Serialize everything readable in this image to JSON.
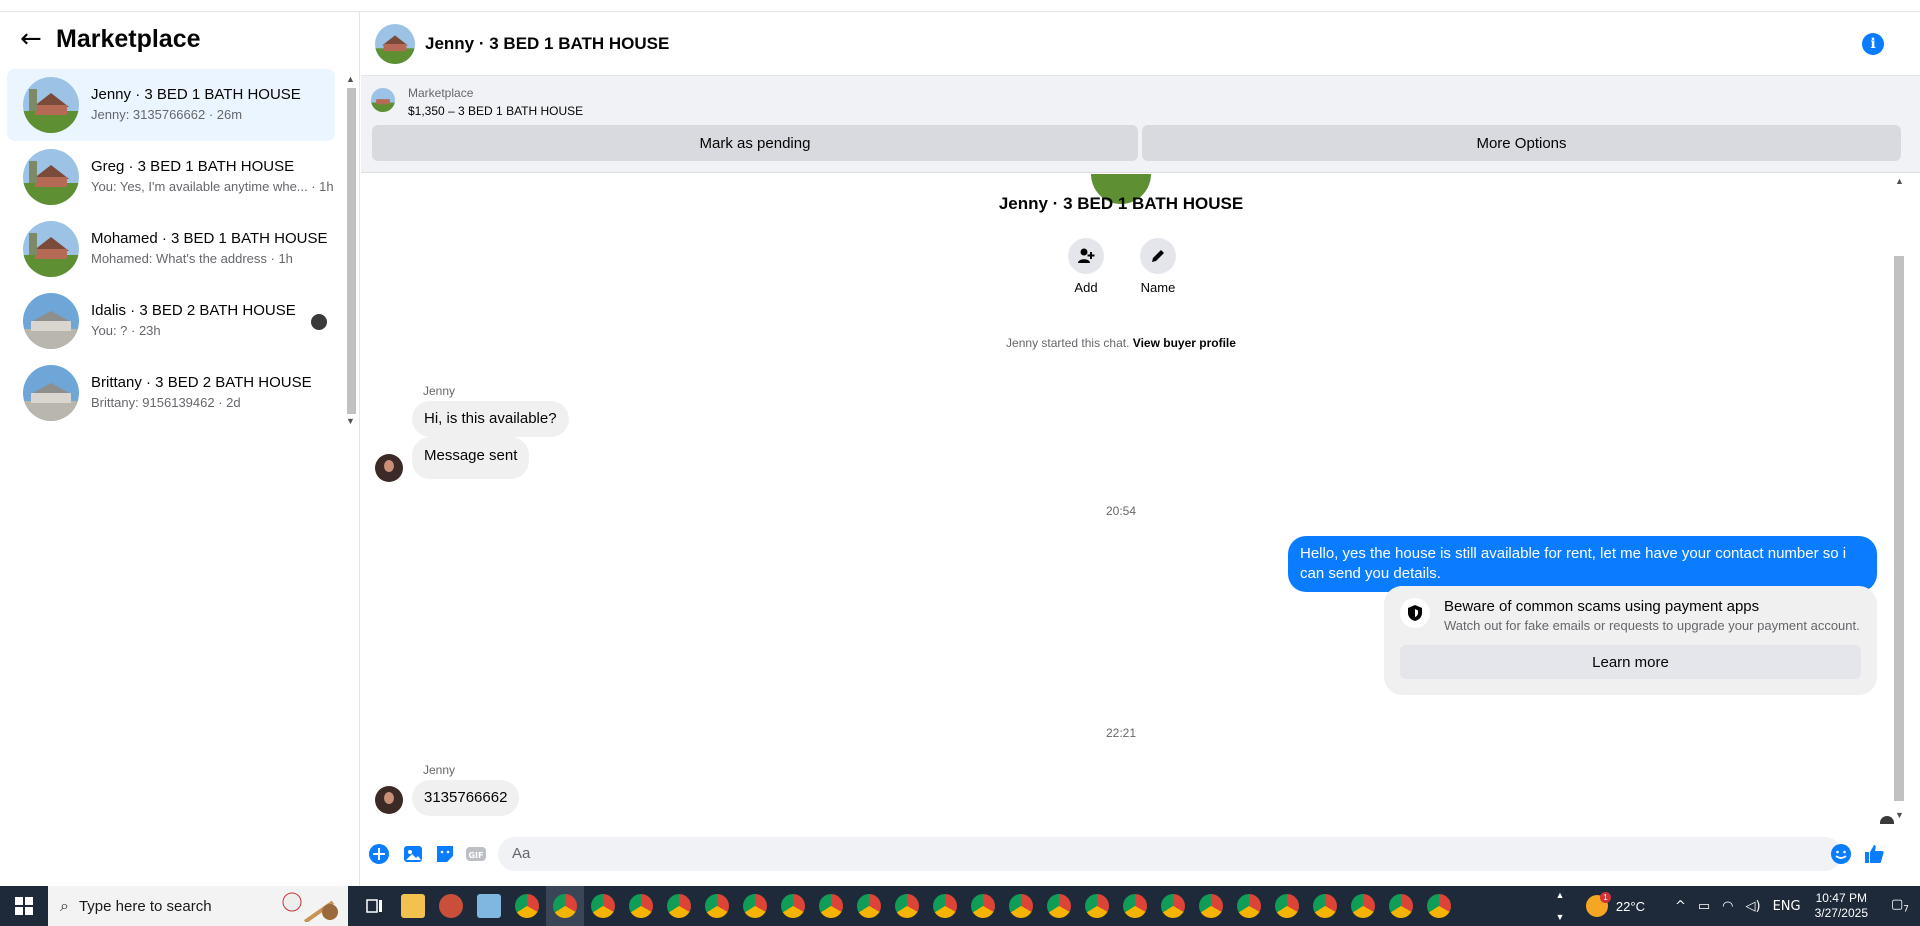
{
  "sidebar": {
    "title": "Marketplace",
    "conversations": [
      {
        "name": "Jenny · 3 BED 1 BATH HOUSE",
        "preview": "Jenny: 3135766662 · 26m",
        "active": true
      },
      {
        "name": "Greg · 3 BED 1 BATH HOUSE",
        "preview": "You: Yes, I'm available anytime whe... · 1h"
      },
      {
        "name": "Mohamed · 3 BED 1 BATH HOUSE",
        "preview": "Mohamed: What's the address · 1h"
      },
      {
        "name": "Idalis · 3 BED 2 BATH HOUSE",
        "preview": "You: ? · 23h"
      },
      {
        "name": "Brittany · 3 BED 2 BATH HOUSE",
        "preview": "Brittany: 9156139462 · 2d"
      }
    ]
  },
  "chat": {
    "header_title": "Jenny · 3 BED 1 BATH HOUSE",
    "listing": {
      "source": "Marketplace",
      "summary": "$1,350 – 3 BED 1 BATH HOUSE",
      "mark_pending": "Mark as pending",
      "more_options": "More Options"
    },
    "profile_name": "Jenny · 3 BED 1 BATH HOUSE",
    "actions": {
      "add": "Add",
      "name": "Name"
    },
    "started_text": "Jenny started this chat.",
    "view_profile": "View buyer profile",
    "messages": {
      "sender1": "Jenny",
      "in1": "Hi, is this available?",
      "in2": "Message sent",
      "time1": "20:54",
      "out1": "Hello, yes the house is still available for rent, let me have your contact number so i can send you details.",
      "time2": "22:21",
      "sender2": "Jenny",
      "in3": "3135766662"
    },
    "scam_notice": {
      "title": "Beware of common scams using payment apps",
      "body": "Watch out for fake emails or requests to upgrade your payment account.",
      "button": "Learn more"
    },
    "composer_placeholder": "Aa"
  },
  "taskbar": {
    "search_placeholder": "Type here to search",
    "weather": "22°C",
    "weather_badge": "1",
    "language": "ENG",
    "time": "10:47 PM",
    "date": "3/27/2025",
    "notification_count": "7"
  },
  "colors": {
    "accent": "#0a7cff",
    "active_bg": "#ebf5ff",
    "taskbar": "#1e2a3a"
  }
}
